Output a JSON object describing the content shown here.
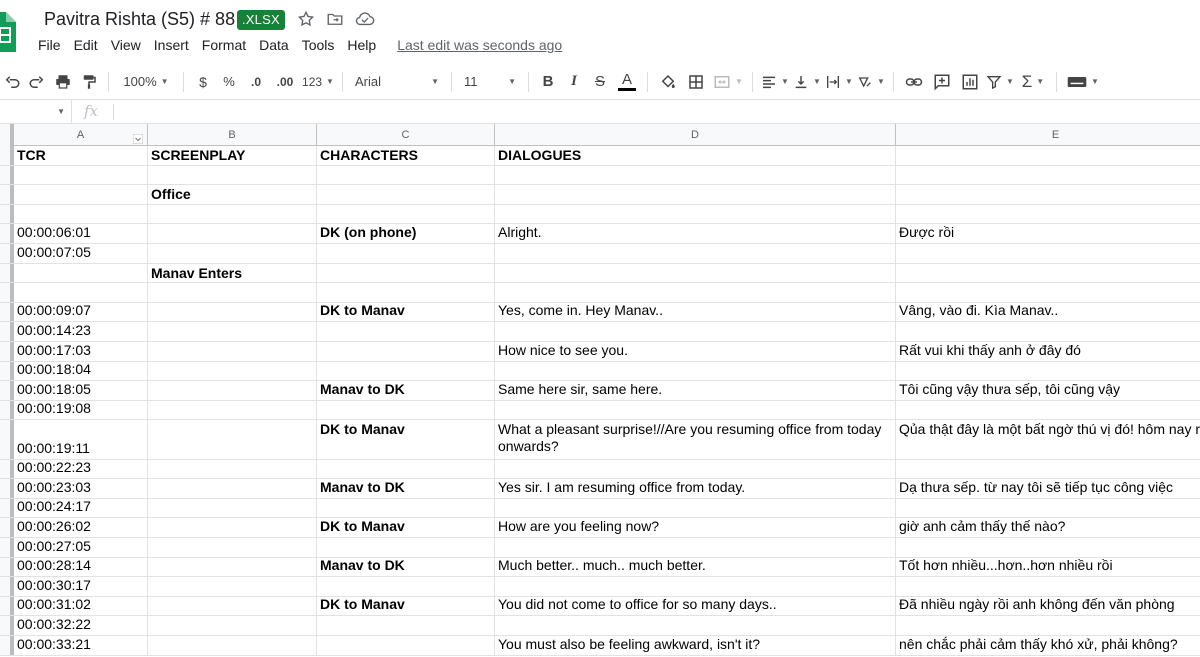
{
  "title_bar": {
    "doc_title": "Pavitra Rishta (S5) # 88",
    "file_badge": ".XLSX",
    "last_edit": "Last edit was seconds ago"
  },
  "menu": [
    "File",
    "Edit",
    "View",
    "Insert",
    "Format",
    "Data",
    "Tools",
    "Help"
  ],
  "toolbar": {
    "zoom": "100%",
    "currency": "$",
    "percent": "%",
    "decrease_decimal": ".0",
    "increase_decimal": ".00",
    "more_formats": "123",
    "font": "Arial",
    "font_size": "11",
    "bold": "B",
    "italic": "I",
    "strike": "S",
    "text_color": "A",
    "accent_color": "#188038"
  },
  "formula_bar": {
    "fx": "fx"
  },
  "columns": [
    "A",
    "B",
    "C",
    "D",
    "E"
  ],
  "rows": [
    {
      "a": "TCR",
      "b": "SCREENPLAY",
      "c": "CHARACTERS",
      "d": "DIALOGUES",
      "e": "",
      "bold": true,
      "top": true
    },
    {
      "a": "",
      "b": "",
      "c": "",
      "d": "",
      "e": ""
    },
    {
      "a": "",
      "b": "Office",
      "c": "",
      "d": "",
      "e": "",
      "top": true
    },
    {
      "a": "",
      "b": "",
      "c": "",
      "d": "",
      "e": ""
    },
    {
      "a": "00:00:06:01",
      "b": "",
      "c": "DK (on phone)",
      "d": "Alright.",
      "e": "Được rồi"
    },
    {
      "a": "00:00:07:05",
      "b": "",
      "c": "",
      "d": "",
      "e": ""
    },
    {
      "a": "",
      "b": "Manav Enters",
      "c": "",
      "d": "",
      "e": "",
      "top": true
    },
    {
      "a": "",
      "b": "",
      "c": "",
      "d": "",
      "e": ""
    },
    {
      "a": "00:00:09:07",
      "b": "",
      "c": "DK to Manav",
      "d": "Yes, come in. Hey Manav..",
      "e": "Vâng, vào đi. Kìa Manav.."
    },
    {
      "a": "00:00:14:23",
      "b": "",
      "c": "",
      "d": "",
      "e": ""
    },
    {
      "a": "00:00:17:03",
      "b": "",
      "c": "",
      "d": "How nice to see you.",
      "e": "Rất vui khi thấy anh ở đây đó"
    },
    {
      "a": "00:00:18:04",
      "b": "",
      "c": "",
      "d": "",
      "e": ""
    },
    {
      "a": "00:00:18:05",
      "b": "",
      "c": "Manav to DK",
      "d": "Same here sir, same here.",
      "e": "Tôi cũng vậy thưa sếp, tôi cũng vậy"
    },
    {
      "a": "00:00:19:08",
      "b": "",
      "c": "",
      "d": "",
      "e": ""
    },
    {
      "a": "00:00:19:11",
      "b": "",
      "c": "DK to Manav",
      "d": "What a pleasant surprise!//Are you resuming office from today onwards?",
      "e": "Qủa thật đây là một bất ngờ thú vị đó! hôm nay rồi",
      "tall": true
    },
    {
      "a": "00:00:22:23",
      "b": "",
      "c": "",
      "d": "",
      "e": ""
    },
    {
      "a": "00:00:23:03",
      "b": "",
      "c": "Manav to DK",
      "d": "Yes sir. I am resuming office from today.",
      "e": "Dạ thưa sếp. từ nay tôi sẽ tiếp tục công việc"
    },
    {
      "a": "00:00:24:17",
      "b": "",
      "c": "",
      "d": "",
      "e": ""
    },
    {
      "a": "00:00:26:02",
      "b": "",
      "c": "DK to Manav",
      "d": "How are you feeling now?",
      "e": "giờ anh cảm thấy thế nào?"
    },
    {
      "a": "00:00:27:05",
      "b": "",
      "c": "",
      "d": "",
      "e": ""
    },
    {
      "a": "00:00:28:14",
      "b": "",
      "c": "Manav to DK",
      "d": "Much better.. much.. much better.",
      "e": "Tốt hơn nhiều...hơn..hơn nhiều rồi"
    },
    {
      "a": "00:00:30:17",
      "b": "",
      "c": "",
      "d": "",
      "e": ""
    },
    {
      "a": "00:00:31:02",
      "b": "",
      "c": "DK to Manav",
      "d": "You did not come to office for so many days..",
      "e": "Đã nhiều ngày rồi anh không đến văn phòng"
    },
    {
      "a": "00:00:32:22",
      "b": "",
      "c": "",
      "d": "",
      "e": ""
    },
    {
      "a": "00:00:33:21",
      "b": "",
      "c": "",
      "d": "You must also be feeling awkward, isn't it?",
      "e": "nên chắc phải cảm thấy khó xử, phải không?"
    }
  ]
}
